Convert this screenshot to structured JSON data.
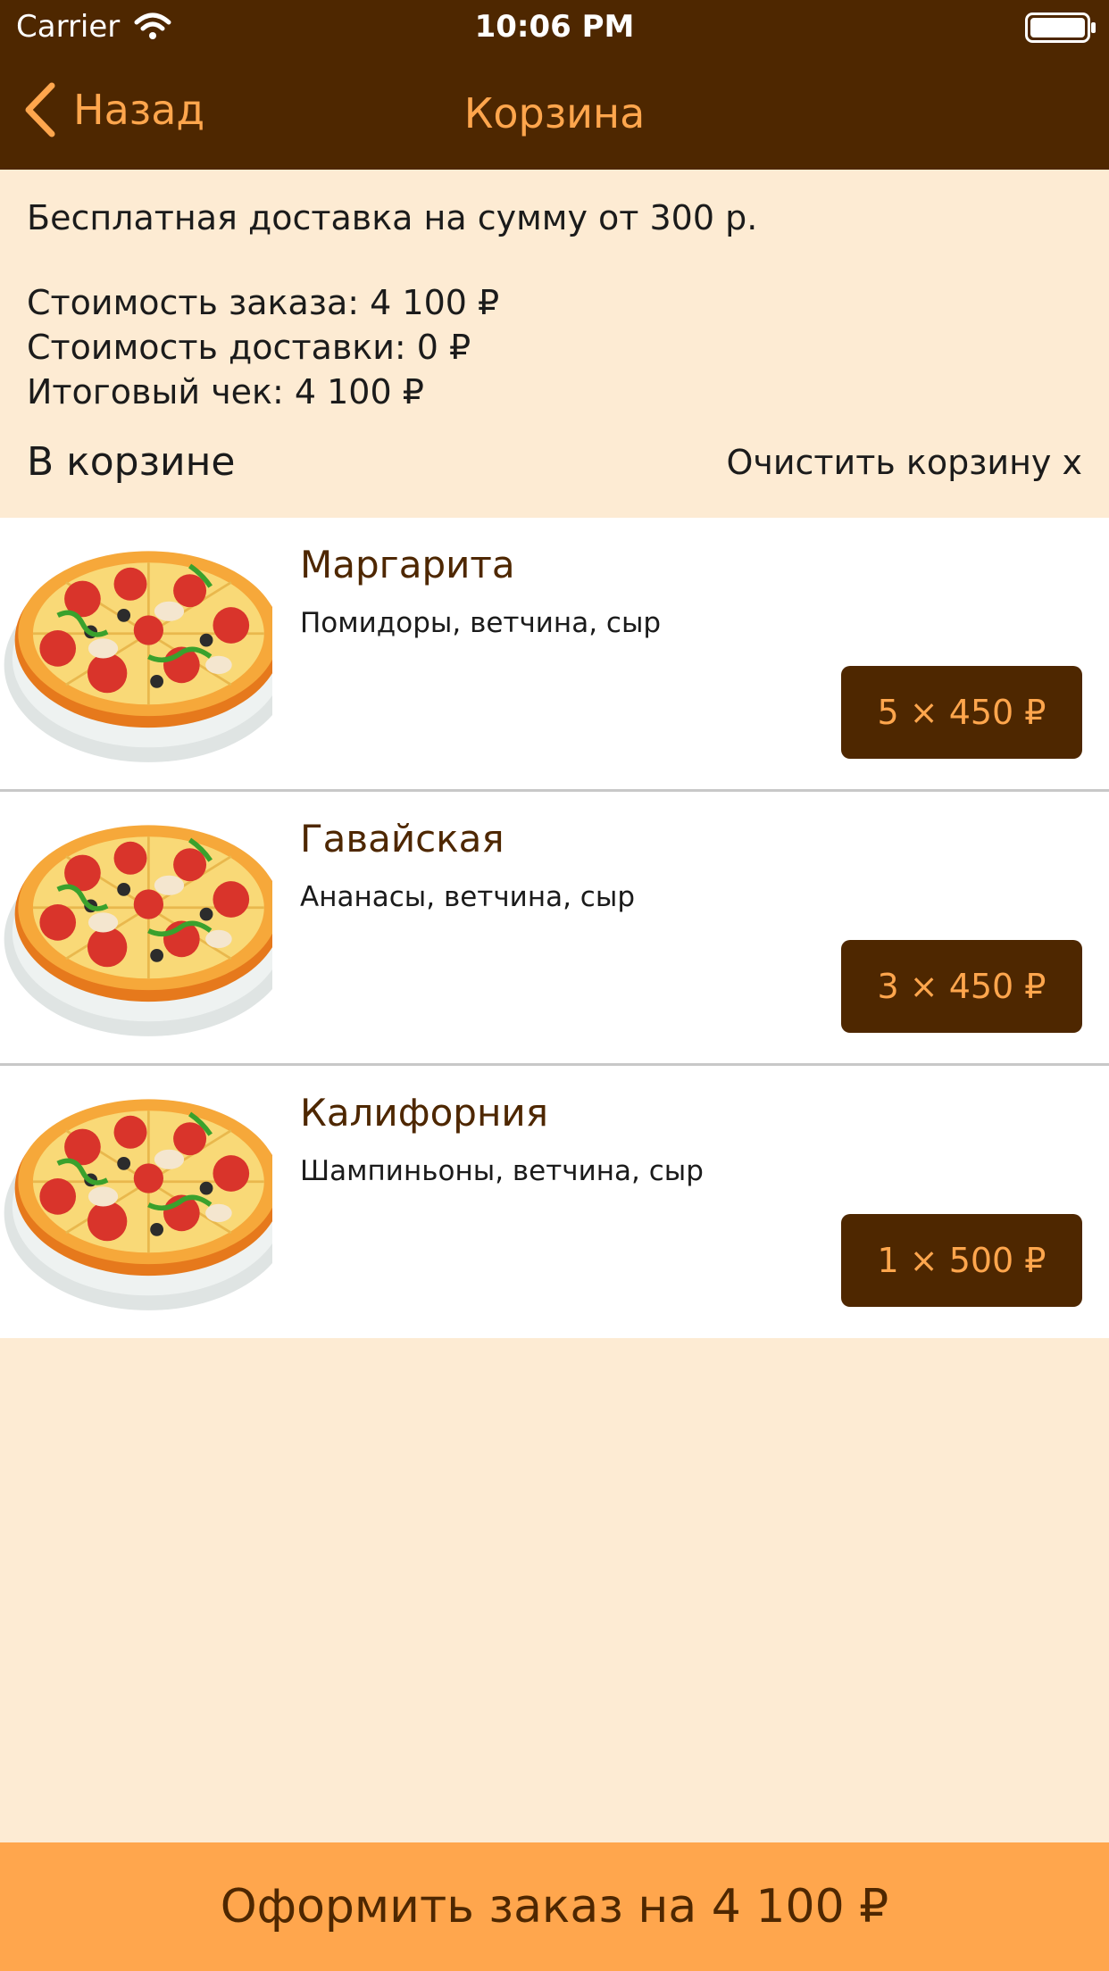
{
  "status_bar": {
    "carrier": "Carrier",
    "time": "10:06 PM"
  },
  "nav": {
    "back_label": "Назад",
    "title": "Корзина"
  },
  "summary": {
    "free_delivery": "Бесплатная доставка на сумму от 300 р.",
    "order_cost": "Стоимость заказа: 4 100 ₽",
    "delivery_cost": "Стоимость доставки: 0 ₽",
    "total": "Итоговый чек: 4 100 ₽",
    "cart_heading": "В корзине",
    "clear_cart": "Очистить корзину x"
  },
  "items": [
    {
      "name": "Маргарита",
      "description": "Помидоры, ветчина, сыр",
      "quantity_price": "5 × 450 ₽"
    },
    {
      "name": "Гавайская",
      "description": "Ананасы, ветчина, сыр",
      "quantity_price": "3 × 450 ₽"
    },
    {
      "name": "Калифорния",
      "description": "Шампиньоны, ветчина, сыр",
      "quantity_price": "1 × 500 ₽"
    }
  ],
  "checkout": {
    "label": "Оформить заказ на 4 100 ₽"
  },
  "icons": {
    "back": "chevron-left-icon",
    "wifi": "wifi-icon",
    "battery": "battery-icon",
    "item_image": "pizza-image"
  },
  "colors": {
    "header_bg": "#4e2700",
    "accent": "#ffa64d",
    "page_bg": "#fdebd3",
    "item_bg": "#ffffff"
  }
}
